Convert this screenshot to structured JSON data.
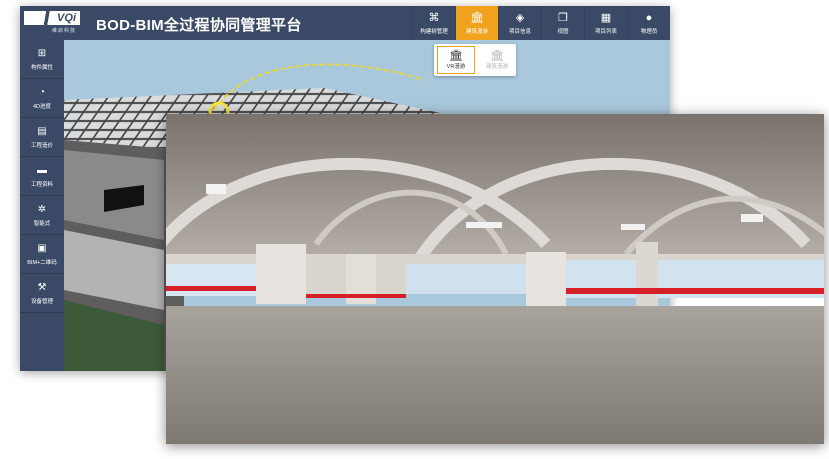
{
  "brand": {
    "logo_text": "VQi",
    "logo_sub": "维启科技"
  },
  "app_title": "BOD-BIM全过程协同管理平台",
  "nav": [
    {
      "label": "构建树管理",
      "icon": "org-tree-icon",
      "glyph": "⌘"
    },
    {
      "label": "建筑漫游",
      "icon": "building-icon",
      "glyph": "🏛",
      "active": true
    },
    {
      "label": "项目信息",
      "icon": "layers-icon",
      "glyph": "◈"
    },
    {
      "label": "视图",
      "icon": "window-icon",
      "glyph": "❐"
    },
    {
      "label": "项目列表",
      "icon": "grid-icon",
      "glyph": "▦"
    },
    {
      "label": "物理员",
      "icon": "user-icon",
      "glyph": "●"
    }
  ],
  "roam_menu": [
    {
      "label": "VR漫游",
      "icon": "vr-building-icon",
      "glyph": "🏛",
      "active": true
    },
    {
      "label": "建筑漫游",
      "icon": "building-roam-icon",
      "glyph": "🏛",
      "active": false
    }
  ],
  "sidebar": [
    {
      "label": "构件属性",
      "icon": "component-icon",
      "glyph": "⊞"
    },
    {
      "label": "4D进度",
      "icon": "pie-chart-icon",
      "glyph": "◔"
    },
    {
      "label": "工程造价",
      "icon": "calculator-icon",
      "glyph": "▤"
    },
    {
      "label": "工程资料",
      "icon": "folder-icon",
      "glyph": "▬"
    },
    {
      "label": "智能式",
      "icon": "gear-icon",
      "glyph": "✲"
    },
    {
      "label": "BIM+二维码",
      "icon": "qr-code-icon",
      "glyph": "▣"
    },
    {
      "label": "设备管理",
      "icon": "tools-icon",
      "glyph": "⚒"
    }
  ],
  "colors": {
    "topbar": "#3a4a66",
    "accent": "#f0a21c",
    "sky": "#a9c8dc",
    "floor_red": "#d61f26",
    "ground": "#8c8780"
  }
}
